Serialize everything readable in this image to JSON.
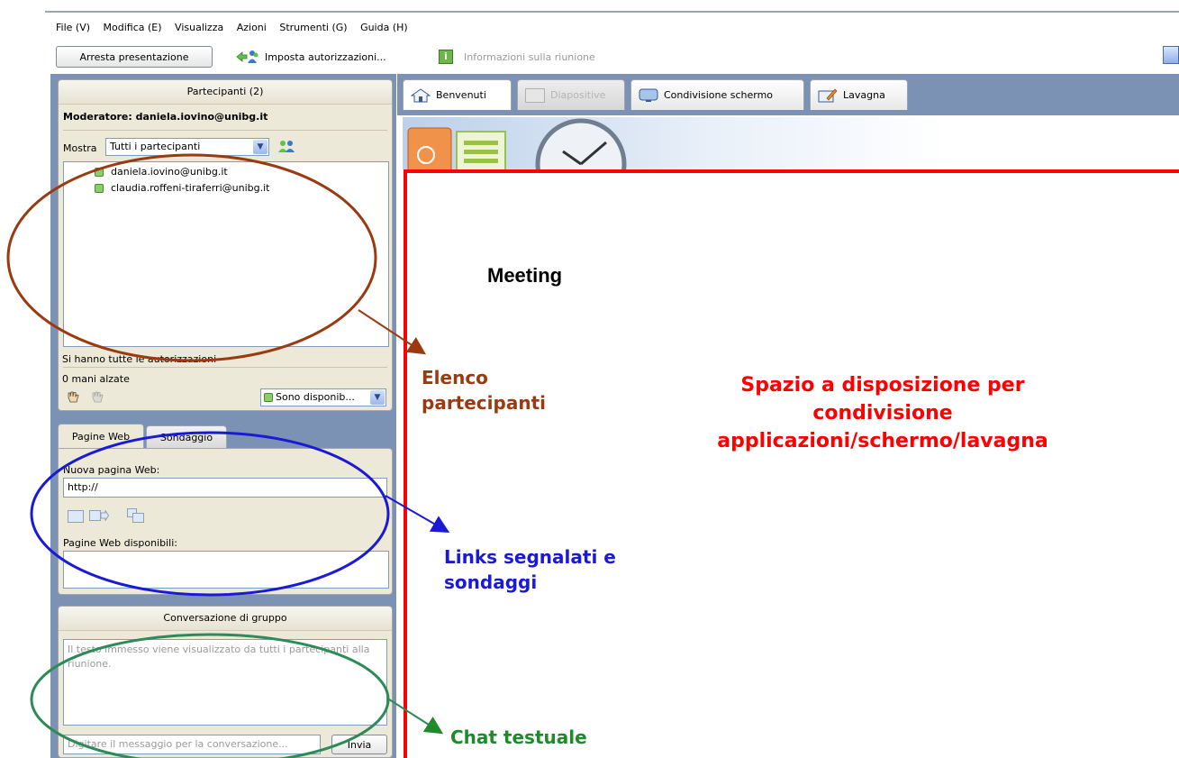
{
  "menu": {
    "items": [
      "File (V)",
      "Modifica (E)",
      "Visualizza",
      "Azioni",
      "Strumenti (G)",
      "Guida (H)"
    ]
  },
  "toolbar": {
    "stop_label": "Arresta presentazione",
    "permissions_label": "Imposta autorizzazioni...",
    "info_label": "Informazioni sulla riunione"
  },
  "participants": {
    "title": "Partecipanti (2)",
    "moderator": "Moderatore: daniela.iovino@unibg.it",
    "show_label": "Mostra",
    "filter_value": "Tutti i partecipanti",
    "list": [
      "daniela.iovino@unibg.it",
      "claudia.roffeni-tiraferri@unibg.it"
    ],
    "permissions_status": "Si hanno tutte le autorizzazioni",
    "hands_raised": "0 mani alzate",
    "status_value": "Sono disponib..."
  },
  "web": {
    "tabs": [
      "Pagine Web",
      "Sondaggio"
    ],
    "new_page_label": "Nuova pagina Web:",
    "url_value": "http://",
    "available_label": "Pagine Web disponibili:"
  },
  "chat": {
    "title": "Conversazione di gruppo",
    "hint": "Il testo immesso viene visualizzato da tutti i partecipanti alla riunione.",
    "input_placeholder": "Digitare il messaggio per la conversazione...",
    "send_label": "Invia"
  },
  "main": {
    "tabs": [
      "Benvenuti",
      "Diapositive",
      "Condivisione schermo",
      "Lavagna"
    ],
    "meeting_title": "Meeting"
  },
  "annotations": {
    "participants": [
      "Elenco",
      "partecipanti"
    ],
    "share": [
      "Spazio a disposizione per",
      "condivisione",
      "applicazioni/schermo/lavagna"
    ],
    "links": [
      "Links segnalati e",
      "sondaggi"
    ],
    "chat": "Chat testuale"
  },
  "colors": {
    "participants_annotation": "#9b3a10",
    "share_annotation": "#ff0000",
    "links_annotation": "#1a1ad6",
    "chat_annotation": "#1e8a2a"
  }
}
